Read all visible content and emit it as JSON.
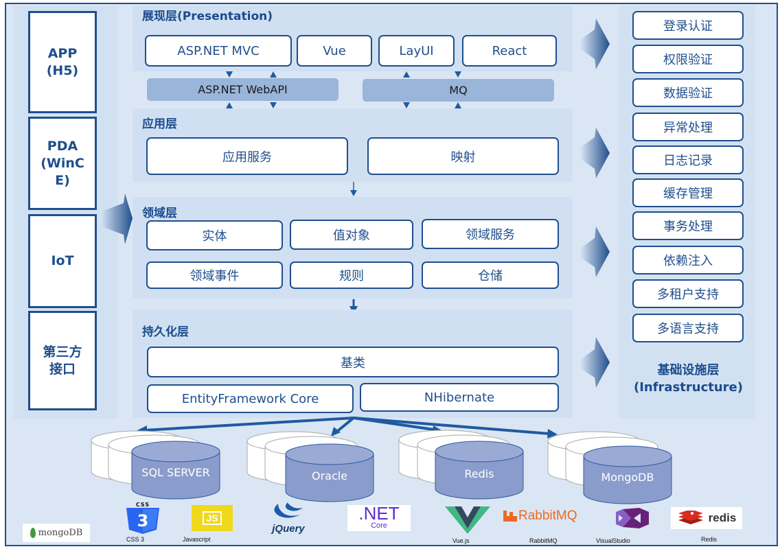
{
  "clients": [
    {
      "label": "APP\n(H5)"
    },
    {
      "label": "PDA\n(WinC\nE)"
    },
    {
      "label": "IoT"
    },
    {
      "label": "第三方\n接口"
    }
  ],
  "presentation": {
    "title": "展现层(Presentation)",
    "items": [
      "ASP.NET MVC",
      "Vue",
      "LayUI",
      "React"
    ]
  },
  "gateways": {
    "webapi": "ASP.NET WebAPI",
    "mq": "MQ"
  },
  "application": {
    "title": "应用层",
    "items": [
      "应用服务",
      "映射"
    ]
  },
  "domain": {
    "title": "领域层",
    "items": [
      "实体",
      "值对象",
      "领域服务",
      "领域事件",
      "规则",
      "仓储"
    ]
  },
  "persistence": {
    "title": "持久化层",
    "base": "基类",
    "items": [
      "EntityFramework Core",
      "NHibernate"
    ]
  },
  "infrastructure": {
    "title": "基础设施层\n(Infrastructure)",
    "items": [
      "登录认证",
      "权限验证",
      "数据验证",
      "异常处理",
      "日志记录",
      "缓存管理",
      "事务处理",
      "依赖注入",
      "多租户支持",
      "多语言支持"
    ]
  },
  "databases": [
    "SQL SERVER",
    "Oracle",
    "Redis",
    "MongoDB"
  ],
  "logos": {
    "mongodb": "mongoDB",
    "css3_top": "CSS",
    "css3": "CSS 3",
    "js_mark": "JS",
    "javascript": "Javascript",
    "jquery": "jQuery",
    "dotnet_main": ".NET",
    "dotnet_sub": "Core",
    "vue": "Vue.js",
    "rabbitmq_logo": "RabbitMQ",
    "rabbitmq": "RabbitMQ",
    "visualstudio": "VisualStudio",
    "redis_logo": "redis",
    "redis": "Redis"
  },
  "colors": {
    "primary": "#1f4e8c",
    "band": "#d0e0f2",
    "background": "#dbe6f4",
    "gateway": "#9ab5da",
    "db_fill": "#8a9ccb"
  }
}
